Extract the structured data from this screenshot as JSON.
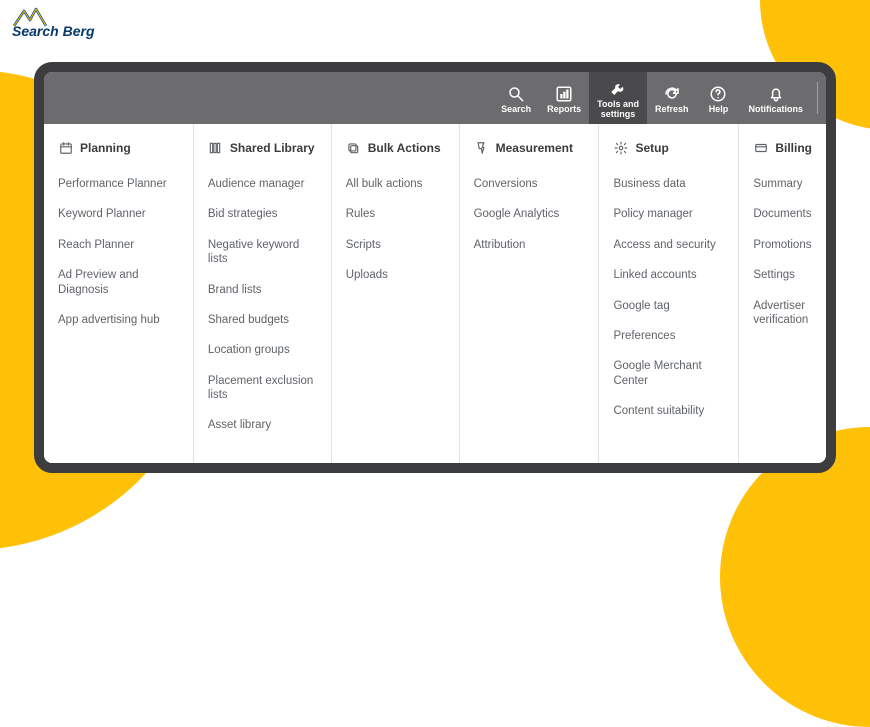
{
  "logo": {
    "line1": "Search",
    "line2": "Berg"
  },
  "toolbar": [
    {
      "id": "search",
      "label": "Search",
      "icon": "search-icon",
      "active": false
    },
    {
      "id": "reports",
      "label": "Reports",
      "icon": "reports-icon",
      "active": false
    },
    {
      "id": "tools",
      "label": "Tools and\nsettings",
      "icon": "wrench-icon",
      "active": true
    },
    {
      "id": "refresh",
      "label": "Refresh",
      "icon": "refresh-icon",
      "active": false
    },
    {
      "id": "help",
      "label": "Help",
      "icon": "help-icon",
      "active": false
    },
    {
      "id": "notif",
      "label": "Notifications",
      "icon": "bell-icon",
      "active": false
    }
  ],
  "columns": [
    {
      "title": "Planning",
      "icon": "calendar-icon",
      "items": [
        "Performance Planner",
        "Keyword Planner",
        "Reach Planner",
        "Ad Preview and Diagnosis",
        "App advertising hub"
      ]
    },
    {
      "title": "Shared Library",
      "icon": "library-icon",
      "items": [
        "Audience manager",
        "Bid strategies",
        "Negative keyword lists",
        "Brand lists",
        "Shared budgets",
        "Location groups",
        "Placement exclusion lists",
        "Asset library"
      ]
    },
    {
      "title": "Bulk Actions",
      "icon": "bulk-icon",
      "items": [
        "All bulk actions",
        "Rules",
        "Scripts",
        "Uploads"
      ]
    },
    {
      "title": "Measurement",
      "icon": "measurement-icon",
      "items": [
        "Conversions",
        "Google Analytics",
        "Attribution"
      ]
    },
    {
      "title": "Setup",
      "icon": "setup-icon",
      "items": [
        "Business data",
        "Policy manager",
        "Access and security",
        "Linked accounts",
        "Google tag",
        "Preferences",
        "Google Merchant Center",
        "Content suitability"
      ]
    },
    {
      "title": "Billing",
      "icon": "billing-icon",
      "items": [
        "Summary",
        "Documents",
        "Promotions",
        "Settings",
        "Advertiser verification"
      ]
    }
  ]
}
